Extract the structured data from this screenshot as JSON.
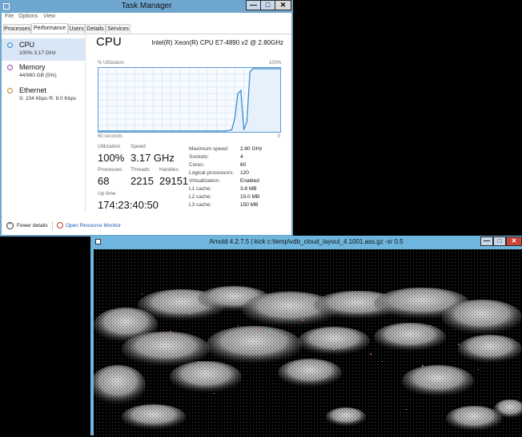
{
  "task_manager": {
    "title": "Task Manager",
    "title_buttons": {
      "minimize": "—",
      "maximize": "□",
      "close": "✕"
    },
    "menu": [
      "File",
      "Options",
      "View"
    ],
    "tabs": [
      "Processes",
      "Performance",
      "Users",
      "Details",
      "Services"
    ],
    "active_tab": "Performance",
    "sidebar": [
      {
        "name": "CPU",
        "detail": "100% 3.17 GHz",
        "color": "#3b8fd4",
        "selected": true
      },
      {
        "name": "Memory",
        "detail": "44/960 GB (5%)",
        "color": "#9b3fb5",
        "selected": false
      },
      {
        "name": "Ethernet",
        "detail": "S: 104 Kbps R: 8.0 Kbps",
        "color": "#c98a2a",
        "selected": false
      }
    ],
    "cpu": {
      "title": "CPU",
      "model": "Intel(R) Xeon(R) CPU E7-4890 v2 @ 2.80GHz",
      "graph_label": "% Utilization",
      "graph_max": "100%",
      "graph_time": "60 seconds",
      "graph_min": "0",
      "graph_color": "#2e86c8",
      "utilization_series": [
        0,
        0,
        0,
        0,
        0,
        0,
        0,
        0,
        0,
        0,
        0,
        0,
        0,
        0,
        0,
        0,
        0,
        0,
        0,
        0,
        0,
        0,
        0,
        0,
        0,
        0,
        0,
        0,
        0,
        0,
        0,
        0,
        0,
        0,
        0,
        0,
        0,
        0,
        0,
        0,
        0,
        0,
        0,
        1,
        2,
        20,
        60,
        65,
        2,
        15,
        95,
        100,
        100,
        100,
        100,
        100,
        100,
        100,
        100,
        100,
        100
      ],
      "stats": {
        "utilization_label": "Utilization",
        "utilization_value": "100%",
        "speed_label": "Speed",
        "speed_value": "3.17 GHz",
        "processes_label": "Processes",
        "processes_value": "68",
        "threads_label": "Threads",
        "threads_value": "2215",
        "handles_label": "Handles",
        "handles_value": "29151",
        "uptime_label": "Up time",
        "uptime_value": "174:23:40:50"
      },
      "specs": [
        {
          "k": "Maximum speed:",
          "v": "2.80 GHz"
        },
        {
          "k": "Sockets:",
          "v": "4"
        },
        {
          "k": "Cores:",
          "v": "60"
        },
        {
          "k": "Logical processors:",
          "v": "120"
        },
        {
          "k": "Virtualization:",
          "v": "Enabled"
        },
        {
          "k": "L1 cache:",
          "v": "3.8 MB"
        },
        {
          "k": "L2 cache:",
          "v": "15.0 MB"
        },
        {
          "k": "L3 cache:",
          "v": "150 MB"
        }
      ]
    },
    "footer": {
      "fewer_details": "Fewer details",
      "resource_monitor": "Open Resource Monitor"
    }
  },
  "arnold": {
    "title": "Arnold 4.2.7.5 | kick c:\\temp\\vdb_cloud_layout_4.1001.ass.gz -sr 0.5",
    "title_buttons": {
      "minimize": "—",
      "maximize": "□",
      "close": "✕"
    }
  }
}
